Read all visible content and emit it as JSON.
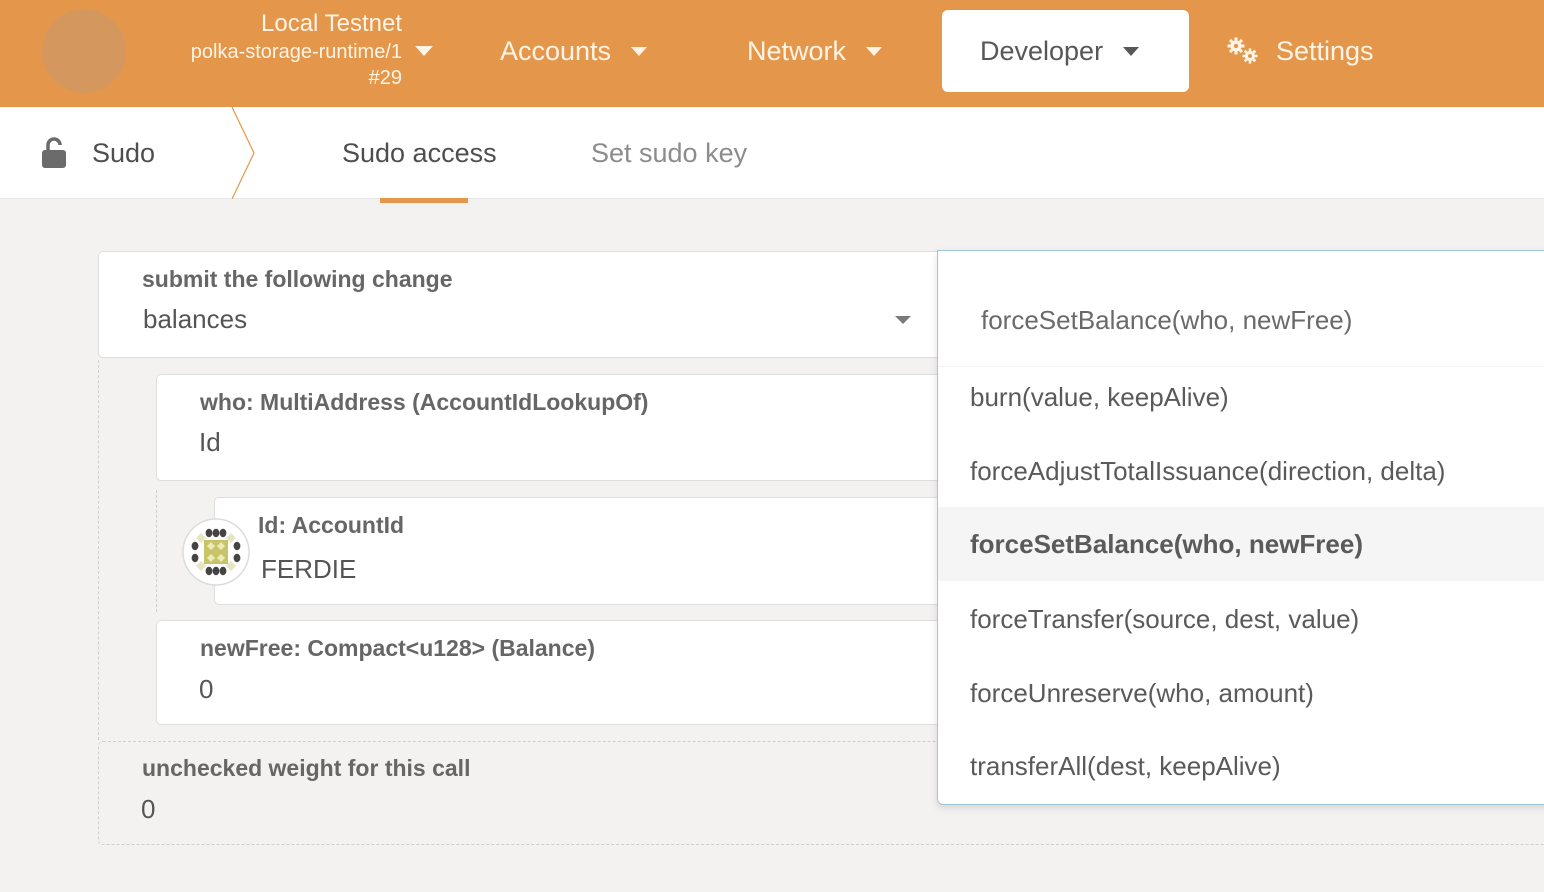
{
  "topbar": {
    "chain_name": "Local Testnet",
    "runtime": "polka-storage-runtime/1",
    "block": "#29",
    "nav": [
      {
        "label": "Accounts",
        "icon": "caret-down-icon"
      },
      {
        "label": "Network",
        "icon": "caret-down-icon"
      },
      {
        "label": "Developer",
        "icon": "caret-down-icon",
        "active": true
      },
      {
        "label": "Settings",
        "icon": "gears-icon"
      }
    ]
  },
  "subheader": {
    "section": "Sudo",
    "section_icon": "unlock-icon",
    "tabs": [
      {
        "label": "Sudo access",
        "active": true
      },
      {
        "label": "Set sudo key",
        "active": false
      }
    ]
  },
  "form": {
    "call": {
      "label": "submit the following change",
      "value": "balances"
    },
    "who": {
      "label": "who: MultiAddress (AccountIdLookupOf)",
      "value": "Id"
    },
    "id": {
      "label": "Id: AccountId",
      "value": "FERDIE"
    },
    "newFree": {
      "label": "newFree: Compact<u128> (Balance)",
      "value": "0"
    },
    "weight": {
      "label": "unchecked weight for this call",
      "value": "0"
    }
  },
  "dropdown": {
    "search_text": "forceSetBalance(who, newFree)",
    "options": [
      {
        "label": "burn(value, keepAlive)"
      },
      {
        "label": "forceAdjustTotalIssuance(direction, delta)"
      },
      {
        "label": "forceSetBalance(who, newFree)",
        "selected": true
      },
      {
        "label": "forceTransfer(source, dest, value)"
      },
      {
        "label": "forceUnreserve(who, amount)"
      },
      {
        "label": "transferAll(dest, keepAlive)"
      }
    ]
  },
  "colors": {
    "accent": "#e4974b",
    "background": "#f3f2f1",
    "dropdown_border": "#9fc6d9"
  }
}
